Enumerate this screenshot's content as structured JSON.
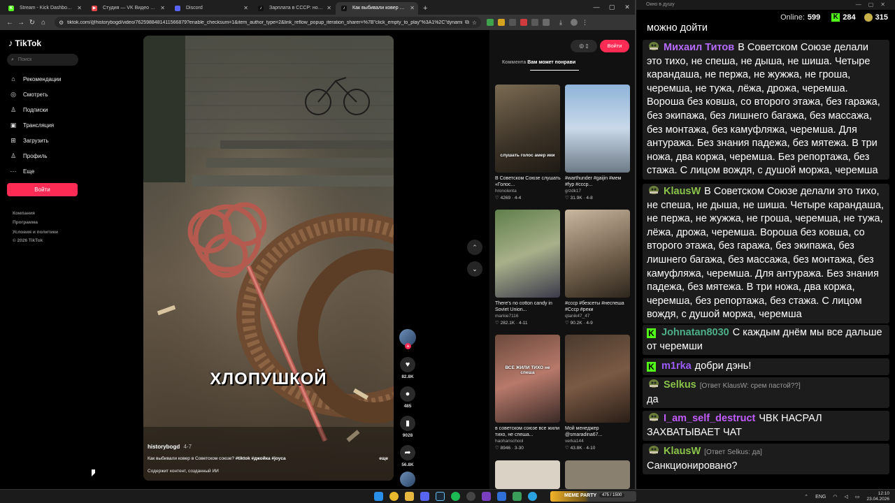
{
  "browser": {
    "tabs": [
      {
        "label": "Stream - Kick Dashboard",
        "fav_color": "#53fc18",
        "fav_text": "K",
        "active": false
      },
      {
        "label": "Студия — VK Видео Live",
        "fav_color": "#e64646",
        "fav_text": "▶",
        "active": false
      },
      {
        "label": "Discord",
        "fav_color": "#5865f2",
        "fav_text": "",
        "active": false
      },
      {
        "label": "Зарплата в СССР: ностальгия",
        "fav_color": "#111111",
        "fav_text": "♪",
        "active": false
      },
      {
        "label": "Как выбивали ковер в СССР: ",
        "fav_color": "#111111",
        "fav_text": "♪",
        "active": true
      }
    ],
    "new_tab": "+",
    "url": "tiktok.com/@historybogd/video/7625988481411566879?enable_checksum=1&item_author_type=2&link_reflow_popup_iteration_sharer=%7B\"click_empty_to_play\"%3A1%2C\"dynami..."
  },
  "tiktok": {
    "logo": "TikTok",
    "search_placeholder": "Поиск",
    "nav": [
      {
        "label": "Рекомендации",
        "icon": "⌂"
      },
      {
        "label": "Смотреть",
        "icon": "◎"
      },
      {
        "label": "Подписки",
        "icon": "♙"
      },
      {
        "label": "Трансляция",
        "icon": "▣"
      },
      {
        "label": "Загрузить",
        "icon": "⊞"
      },
      {
        "label": "Профиль",
        "icon": "♙"
      },
      {
        "label": "Еще",
        "icon": "···"
      }
    ],
    "login": "Войти",
    "footer": [
      "Компания",
      "Программа",
      "Условия и политики",
      "© 2026 TikTok"
    ],
    "video": {
      "overlay_text": "ХЛОПУШКОЙ",
      "author": "historybogd",
      "date": "4-7",
      "desc": "Как выбивали ковер в Советском союзе? ",
      "tags": "#tiktok #джойка #joyca",
      "more": "еще",
      "ai_note": "Содержит контент, созданный ИИ"
    },
    "actions": {
      "likes": "82.8K",
      "comments": "485",
      "saves": "9028",
      "shares": "56.8K"
    },
    "right_panel": {
      "login": "Войти",
      "tabs": [
        "Коммента",
        "Вам может понрави"
      ],
      "cards": [
        {
          "title": "В Советском Союзе слушать «Голос...",
          "author": "hronolenta",
          "stats": "♡ 4269 · 4-4",
          "thumb_text": "слушать голос амер ики"
        },
        {
          "title": "#warthunder #gaijin #мем #fyp #ссср...",
          "author": "grzdk17",
          "stats": "♡ 31.9K · 4-8",
          "thumb_text": ""
        },
        {
          "title": "There's no cotton candy in Soviet Union...",
          "author": "markie7116",
          "stats": "♡ 282.1K · 4-11",
          "thumb_text": ""
        },
        {
          "title": "#ссср #безсеты #неспеша #Ссср #реки",
          "author": "qtanik47_47",
          "stats": "♡ 90.2K · 4-9",
          "thumb_text": ""
        },
        {
          "title": "в советском союзе все жили тихо, не спеша...",
          "author": "haohanschool",
          "stats": "♡ 8946 · 3-30",
          "thumb_text": "ВСЕ ЖИЛИ ТИХО не спеша"
        },
        {
          "title": "Мой менеджер @smaradina67...",
          "author": "verka144",
          "stats": "♡ 43.8K · 4-10",
          "thumb_text": ""
        }
      ]
    }
  },
  "chat": {
    "window_title": "Окно в душу",
    "online_label": "Online:",
    "online": "599",
    "kick_count": "284",
    "points": "315",
    "messages": [
      {
        "user": "",
        "color": "#ffffff",
        "badge": "none",
        "reply": "",
        "text": "можно дойти"
      },
      {
        "user": "Михаил Титов",
        "color": "#b66bff",
        "badge": "sub",
        "reply": "",
        "text": "В Советском Союзе делали это тихо, не спеша, не дыша, не шиша. Четыре карандаша, не пержа, не жужжа, не гроша, черемша, не тужа, лёжа, дрожа, черемша. Вороша без ковша, со второго этажа, без гаража, без экипажа, без лишнего багажа, без массажа, без монтажа, без камуфляжа, черемша. Для антуража. Без знания падежа, без мятежа. В три ножа, два коржа, черемша. Без репортажа, без стажа. С лицом вождя, с душой моржа, черемша"
      },
      {
        "user": "KlausW",
        "color": "#8bc34a",
        "badge": "sub",
        "reply": "",
        "text": "В Советском Союзе делали это тихо, не спеша, не дыша, не шиша. Четыре карандаша, не пержа, не жужжа, не гроша, черемша, не тужа, лёжа, дрожа, черемша. Вороша без ковша, со второго этажа, без гаража, без экипажа, без лишнего багажа, без массажа, без монтажа, без камуфляжа, черемша. Для антуража. Без знания падежа, без мятежа. В три ножа, два коржа, черемша, без репортажа, без стажа. С лицом вождя, с душой моржа, черемша"
      },
      {
        "user": "Johnatan8030",
        "color": "#4caf88",
        "badge": "kick",
        "reply": "",
        "text": "С каждым днём мы все дальше от черемши"
      },
      {
        "user": "m1rka",
        "color": "#9c5cff",
        "badge": "kick",
        "reply": "",
        "text": "добри дэнь!"
      },
      {
        "user": "Selkus",
        "color": "#8bc34a",
        "badge": "sub",
        "reply": "[Ответ KlausW: срем пастой??]",
        "text": "да"
      },
      {
        "user": "I_am_self_destruct",
        "color": "#c15cff",
        "badge": "sub",
        "reply": "",
        "text": "ЧВК НАСРАЛ ЗАХВАТЫВАЕТ ЧАТ"
      },
      {
        "user": "KlausW",
        "color": "#8bc34a",
        "badge": "sub",
        "reply": "[Ответ Selkus: да]",
        "text": "Санкционировано?"
      }
    ]
  },
  "taskbar": {
    "widget_label": "MEME PARTY",
    "widget_value": "475 / 1500",
    "lang": "ENG",
    "time": "12:10",
    "date": "23.04.2026"
  }
}
